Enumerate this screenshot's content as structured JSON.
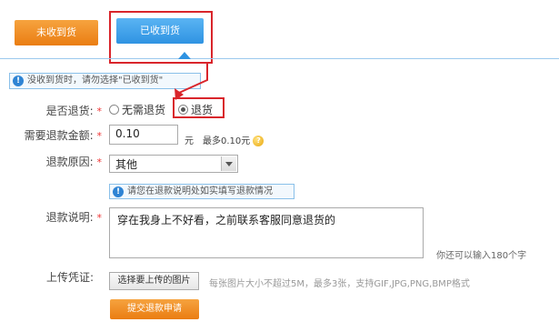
{
  "tabs": {
    "not_received": "未收到货",
    "received": "已收到货"
  },
  "info": {
    "text": "没收到货时，请勿选择\"已收到货\""
  },
  "return": {
    "label": "是否退货:",
    "required": "*",
    "option_no": "无需退货",
    "option_yes": "退货",
    "selected": "退货"
  },
  "amount": {
    "label": "需要退款金额:",
    "required": "*",
    "value": "0.10",
    "unit": "元",
    "max": "最多0.10元",
    "coin_icon": "coin-question-icon"
  },
  "reason": {
    "label": "退款原因:",
    "required": "*",
    "value": "其他",
    "hint": "请您在退款说明处如实填写退款情况"
  },
  "description": {
    "label": "退款说明:",
    "required": "*",
    "value": "穿在我身上不好看，之前联系客服同意退货的",
    "remaining": "你还可以输入180个字"
  },
  "upload": {
    "label": "上传凭证:",
    "button": "选择要上传的图片",
    "note": "每张图片大小不超过5M，最多3张，支持GIF,JPG,PNG,BMP格式"
  },
  "submit": {
    "label": "提交退款申请"
  },
  "colors": {
    "orange": "#ea7d12",
    "blue": "#2f93e2",
    "highlight_red": "#d9252b"
  }
}
